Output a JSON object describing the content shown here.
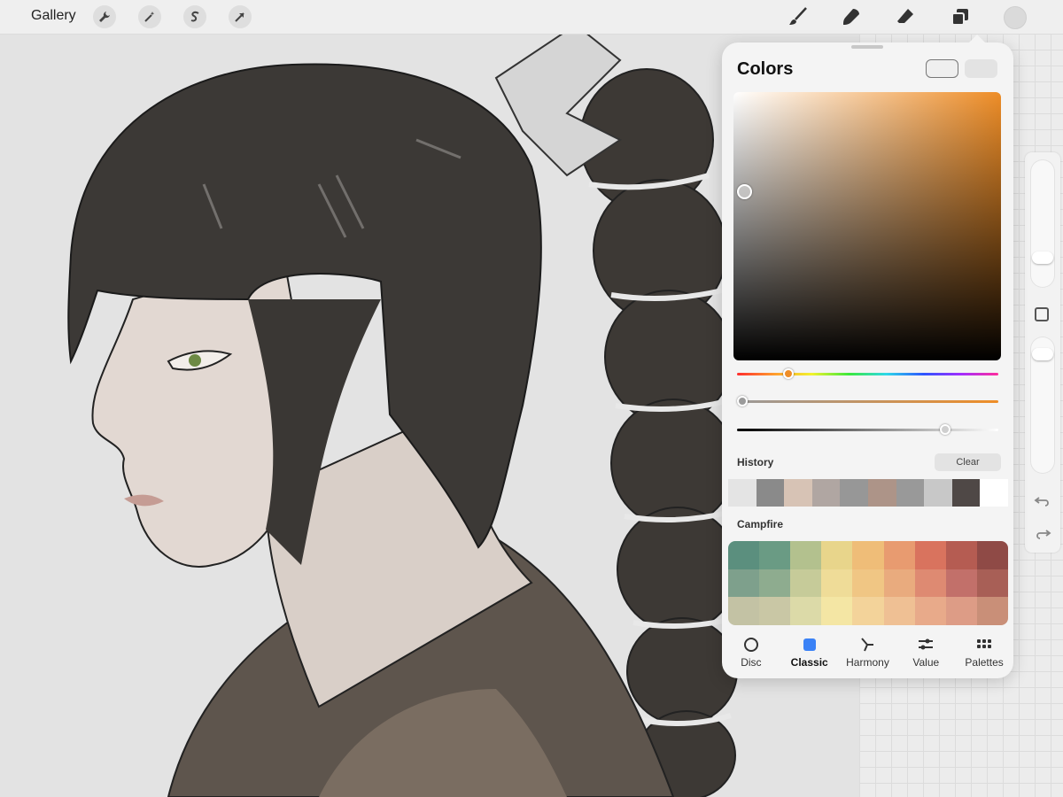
{
  "toolbar": {
    "gallery_label": "Gallery",
    "left_icons": [
      "wrench-icon",
      "magic-wand-icon",
      "selection-s-icon",
      "arrow-cursor-icon"
    ],
    "right_icons": [
      "brush-icon",
      "smudge-icon",
      "eraser-icon",
      "layers-icon"
    ]
  },
  "colors_panel": {
    "title": "Colors",
    "current_color": "#efefef",
    "previous_color": "#e3e3e3",
    "hue_color": "#ee8d27",
    "history_label": "History",
    "clear_label": "Clear",
    "history_colors": [
      "#e4e4e4",
      "#8a8a8a",
      "#d7c3b5",
      "#b0a6a2",
      "#979797",
      "#ad9488",
      "#999999",
      "#c8c8c8",
      "#4f4846",
      "#ffffff"
    ],
    "palette_name": "Campfire",
    "palette_colors": [
      "#5b8f7e",
      "#6a9b84",
      "#b3c18e",
      "#e8d58b",
      "#efbd78",
      "#e89b70",
      "#d9735e",
      "#b55c52",
      "#8f4a46",
      "#7ea08c",
      "#8eac8f",
      "#c6cb99",
      "#efdc98",
      "#f0c684",
      "#e9ab7e",
      "#de8a72",
      "#c2706a",
      "#a85f56",
      "#c3c2a4",
      "#c9c7a5",
      "#dcdaa8",
      "#f4e6a4",
      "#f3d39a",
      "#efc094",
      "#e8aa8a",
      "#dd9c86",
      "#c98f78"
    ],
    "tabs": [
      {
        "label": "Disc",
        "icon": "disc-icon",
        "active": false
      },
      {
        "label": "Classic",
        "icon": "classic-square-icon",
        "active": true
      },
      {
        "label": "Harmony",
        "icon": "harmony-icon",
        "active": false
      },
      {
        "label": "Value",
        "icon": "value-sliders-icon",
        "active": false
      },
      {
        "label": "Palettes",
        "icon": "palettes-grid-icon",
        "active": false
      }
    ]
  }
}
